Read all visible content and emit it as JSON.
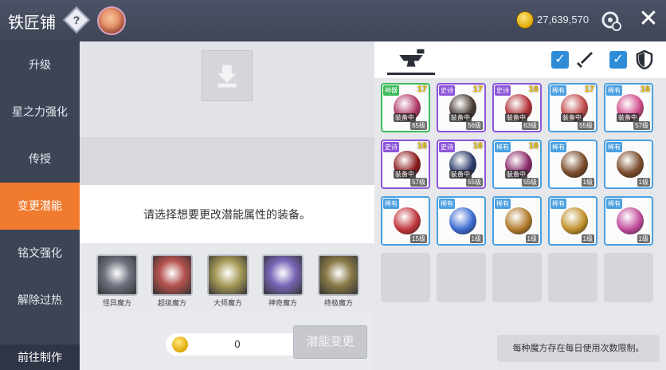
{
  "header": {
    "title": "铁匠铺",
    "help_label": "?",
    "meso": "27,639,570",
    "close_label": "✕"
  },
  "nav": {
    "items": [
      {
        "label": "升级"
      },
      {
        "label": "星之力强化"
      },
      {
        "label": "传授"
      },
      {
        "label": "变更潜能"
      },
      {
        "label": "铭文强化"
      },
      {
        "label": "解除过热"
      }
    ],
    "active_index": 3,
    "bottom_label": "前往制作"
  },
  "middle": {
    "instruction": "请选择想要更改潜能属性的装备。",
    "cubes": [
      {
        "label": "怪异魔方",
        "color": "#6f7380"
      },
      {
        "label": "超级魔方",
        "color": "#b5524e"
      },
      {
        "label": "大师魔方",
        "color": "#a79b58"
      },
      {
        "label": "神奇魔方",
        "color": "#7a66b8"
      },
      {
        "label": "终极魔方",
        "color": "#8a7a48"
      }
    ],
    "cost": "0",
    "change_button": "潜能变更"
  },
  "right": {
    "filters": [
      {
        "icon": "sword-icon",
        "checked": true
      },
      {
        "icon": "shield-icon",
        "checked": true
      }
    ],
    "items": [
      {
        "rarity": "神器",
        "rcolor": "#3dbb5a",
        "level": "17",
        "equipped": "装备中",
        "req": "65级",
        "pic": "#b03a6a"
      },
      {
        "rarity": "史诗",
        "rcolor": "#8c55d9",
        "level": "17",
        "equipped": "装备中",
        "req": "56级",
        "pic": "#4a3a34"
      },
      {
        "rarity": "史诗",
        "rcolor": "#8c55d9",
        "level": "16",
        "equipped": "装备中",
        "req": "63级",
        "pic": "#b2343a"
      },
      {
        "rarity": "稀有",
        "rcolor": "#4aa0e0",
        "level": "17",
        "equipped": "装备中",
        "req": "55级",
        "pic": "#c04a4a"
      },
      {
        "rarity": "稀有",
        "rcolor": "#4aa0e0",
        "level": "16",
        "equipped": "装备中",
        "req": "57级",
        "pic": "#d04a8a"
      },
      {
        "rarity": "史诗",
        "rcolor": "#8c55d9",
        "level": "16",
        "equipped": "装备中",
        "req": "57级",
        "pic": "#8a1a1a"
      },
      {
        "rarity": "史诗",
        "rcolor": "#8c55d9",
        "level": "16",
        "equipped": "装备中",
        "req": "55级",
        "pic": "#2b3a6a"
      },
      {
        "rarity": "稀有",
        "rcolor": "#4aa0e0",
        "level": "16",
        "equipped": "装备中",
        "req": "55级",
        "pic": "#8a2a6a"
      },
      {
        "rarity": "稀有",
        "rcolor": "#4aa0e0",
        "level": "",
        "equipped": "",
        "req": "1级",
        "pic": "#7a4a2a"
      },
      {
        "rarity": "稀有",
        "rcolor": "#4aa0e0",
        "level": "",
        "equipped": "",
        "req": "1级",
        "pic": "#7a4a2a"
      },
      {
        "rarity": "稀有",
        "rcolor": "#4aa0e0",
        "level": "",
        "equipped": "",
        "req": "15级",
        "pic": "#c0343a"
      },
      {
        "rarity": "稀有",
        "rcolor": "#4aa0e0",
        "level": "",
        "equipped": "",
        "req": "1级",
        "pic": "#3a6ad0"
      },
      {
        "rarity": "稀有",
        "rcolor": "#4aa0e0",
        "level": "",
        "equipped": "",
        "req": "1级",
        "pic": "#b07a2a"
      },
      {
        "rarity": "稀有",
        "rcolor": "#4aa0e0",
        "level": "",
        "equipped": "",
        "req": "1级",
        "pic": "#c0902a"
      },
      {
        "rarity": "稀有",
        "rcolor": "#4aa0e0",
        "level": "",
        "equipped": "",
        "req": "1级",
        "pic": "#c04a9a"
      }
    ],
    "notice": "每种魔方存在每日使用次数限制。"
  }
}
